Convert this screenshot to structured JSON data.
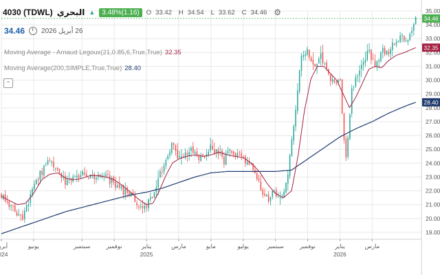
{
  "header": {
    "symbol": "4030 (TDWL)",
    "name": "البحري",
    "change": "3.48%(1.16)",
    "ohlc": [
      {
        "k": "O",
        "v": "33.42"
      },
      {
        "k": "H",
        "v": "34.54"
      },
      {
        "k": "L",
        "v": "33.62"
      },
      {
        "k": "C",
        "v": "34.46"
      }
    ],
    "last_price": "34.46",
    "last_date": "26 أبريل 2026"
  },
  "indicators": {
    "alma_label": "Moving Average - Arnaud Legoux(21,0.85,6,True,True)",
    "alma_value": "32.35",
    "sma_label": "Moving Average(200,SIMPLE,True,True)",
    "sma_value": "28.40"
  },
  "chart_data": {
    "type": "candlestick",
    "y_range": [
      18.5,
      35.0
    ],
    "y_ticks": [
      "19.00",
      "20.00",
      "21.00",
      "22.00",
      "23.00",
      "24.00",
      "25.00",
      "26.00",
      "27.00",
      "28.00",
      "29.00",
      "30.00",
      "31.00",
      "32.00",
      "33.00",
      "34.00",
      "35.00"
    ],
    "x_ticks": [
      {
        "label": "أبريل",
        "year": "2024",
        "t": 0.0
      },
      {
        "label": "يونيو",
        "year": "",
        "t": 2.0
      },
      {
        "label": "سبتمبر",
        "year": "",
        "t": 5.0
      },
      {
        "label": "نوفمبر",
        "year": "",
        "t": 7.0
      },
      {
        "label": "يناير",
        "year": "2025",
        "t": 9.0
      },
      {
        "label": "مارس",
        "year": "",
        "t": 11.0
      },
      {
        "label": "مايو",
        "year": "",
        "t": 13.0
      },
      {
        "label": "يوليو",
        "year": "",
        "t": 15.0
      },
      {
        "label": "سبتمبر",
        "year": "",
        "t": 17.0
      },
      {
        "label": "نوفمبر",
        "year": "",
        "t": 19.0
      },
      {
        "label": "يناير",
        "year": "2026",
        "t": 21.0
      },
      {
        "label": "مارس",
        "year": "",
        "t": 23.0
      }
    ],
    "t_max": 25.8,
    "price_anchors": [
      [
        0.0,
        21.8
      ],
      [
        0.5,
        21.0
      ],
      [
        1.0,
        20.3
      ],
      [
        1.3,
        20.1
      ],
      [
        1.8,
        21.5
      ],
      [
        2.2,
        22.8
      ],
      [
        2.6,
        23.6
      ],
      [
        3.0,
        24.1
      ],
      [
        3.5,
        23.2
      ],
      [
        4.0,
        22.6
      ],
      [
        4.5,
        23.0
      ],
      [
        5.0,
        23.2
      ],
      [
        5.5,
        22.9
      ],
      [
        6.0,
        23.2
      ],
      [
        6.5,
        23.0
      ],
      [
        7.0,
        22.5
      ],
      [
        7.5,
        22.0
      ],
      [
        8.0,
        21.7
      ],
      [
        8.5,
        21.0
      ],
      [
        9.0,
        20.9
      ],
      [
        9.4,
        21.6
      ],
      [
        9.8,
        23.0
      ],
      [
        10.2,
        24.3
      ],
      [
        10.6,
        25.4
      ],
      [
        11.0,
        24.2
      ],
      [
        11.4,
        24.8
      ],
      [
        11.8,
        25.0
      ],
      [
        12.2,
        24.3
      ],
      [
        12.6,
        24.6
      ],
      [
        13.0,
        25.1
      ],
      [
        13.4,
        24.8
      ],
      [
        13.8,
        24.2
      ],
      [
        14.2,
        25.0
      ],
      [
        14.6,
        24.6
      ],
      [
        15.0,
        24.3
      ],
      [
        15.4,
        24.0
      ],
      [
        15.8,
        23.2
      ],
      [
        16.2,
        21.9
      ],
      [
        16.6,
        21.5
      ],
      [
        17.0,
        21.9
      ],
      [
        17.4,
        21.6
      ],
      [
        17.7,
        22.5
      ],
      [
        18.0,
        25.5
      ],
      [
        18.3,
        28.5
      ],
      [
        18.6,
        31.5
      ],
      [
        19.0,
        32.0
      ],
      [
        19.4,
        31.0
      ],
      [
        19.8,
        31.8
      ],
      [
        20.2,
        30.5
      ],
      [
        20.6,
        29.8
      ],
      [
        21.0,
        30.2
      ],
      [
        21.2,
        26.0
      ],
      [
        21.4,
        24.2
      ],
      [
        21.7,
        29.0
      ],
      [
        22.0,
        30.2
      ],
      [
        22.4,
        31.5
      ],
      [
        22.8,
        32.0
      ],
      [
        23.2,
        30.8
      ],
      [
        23.6,
        32.2
      ],
      [
        24.0,
        32.0
      ],
      [
        24.4,
        32.8
      ],
      [
        24.8,
        33.0
      ],
      [
        25.2,
        32.9
      ],
      [
        25.5,
        33.6
      ],
      [
        25.7,
        34.46
      ]
    ],
    "alma_anchors": [
      [
        0.0,
        21.6
      ],
      [
        0.5,
        21.3
      ],
      [
        1.0,
        21.0
      ],
      [
        1.5,
        21.1
      ],
      [
        2.0,
        21.8
      ],
      [
        2.5,
        22.8
      ],
      [
        3.0,
        23.2
      ],
      [
        3.5,
        23.3
      ],
      [
        4.0,
        22.9
      ],
      [
        4.5,
        22.8
      ],
      [
        5.0,
        22.9
      ],
      [
        5.5,
        23.1
      ],
      [
        6.0,
        23.1
      ],
      [
        6.5,
        23.0
      ],
      [
        7.0,
        22.8
      ],
      [
        7.5,
        22.4
      ],
      [
        8.0,
        21.9
      ],
      [
        8.5,
        21.4
      ],
      [
        9.0,
        21.0
      ],
      [
        9.4,
        21.1
      ],
      [
        9.8,
        22.0
      ],
      [
        10.2,
        23.1
      ],
      [
        10.6,
        24.0
      ],
      [
        11.0,
        24.3
      ],
      [
        11.5,
        24.5
      ],
      [
        12.0,
        24.6
      ],
      [
        12.5,
        24.5
      ],
      [
        13.0,
        24.6
      ],
      [
        13.5,
        24.8
      ],
      [
        14.0,
        24.6
      ],
      [
        14.5,
        24.5
      ],
      [
        15.0,
        24.4
      ],
      [
        15.5,
        24.0
      ],
      [
        16.0,
        23.4
      ],
      [
        16.5,
        22.5
      ],
      [
        17.0,
        21.8
      ],
      [
        17.5,
        21.5
      ],
      [
        18.0,
        22.0
      ],
      [
        18.4,
        24.5
      ],
      [
        18.8,
        27.8
      ],
      [
        19.2,
        30.1
      ],
      [
        19.6,
        31.0
      ],
      [
        20.0,
        31.0
      ],
      [
        20.4,
        30.5
      ],
      [
        20.8,
        30.0
      ],
      [
        21.2,
        29.0
      ],
      [
        21.6,
        28.0
      ],
      [
        22.0,
        28.8
      ],
      [
        22.4,
        29.8
      ],
      [
        22.8,
        30.8
      ],
      [
        23.2,
        31.0
      ],
      [
        23.6,
        30.9
      ],
      [
        24.0,
        31.4
      ],
      [
        24.5,
        31.8
      ],
      [
        25.0,
        32.0
      ],
      [
        25.4,
        32.2
      ],
      [
        25.7,
        32.35
      ]
    ],
    "sma_anchors": [
      [
        0.0,
        18.9
      ],
      [
        1.0,
        19.3
      ],
      [
        2.0,
        19.7
      ],
      [
        3.0,
        20.1
      ],
      [
        4.0,
        20.5
      ],
      [
        5.0,
        20.8
      ],
      [
        6.0,
        21.1
      ],
      [
        7.0,
        21.4
      ],
      [
        8.0,
        21.7
      ],
      [
        9.0,
        21.9
      ],
      [
        10.0,
        22.2
      ],
      [
        11.0,
        22.6
      ],
      [
        12.0,
        23.0
      ],
      [
        13.0,
        23.3
      ],
      [
        14.0,
        23.4
      ],
      [
        15.0,
        23.4
      ],
      [
        16.0,
        23.4
      ],
      [
        17.0,
        23.4
      ],
      [
        18.0,
        23.5
      ],
      [
        19.0,
        24.3
      ],
      [
        20.0,
        25.1
      ],
      [
        21.0,
        25.9
      ],
      [
        22.0,
        26.5
      ],
      [
        23.0,
        27.0
      ],
      [
        24.0,
        27.6
      ],
      [
        25.0,
        28.1
      ],
      [
        25.7,
        28.4
      ]
    ],
    "markers": [
      {
        "value": "34.46",
        "y": 34.46,
        "color": "#4caf50"
      },
      {
        "value": "32.35",
        "y": 32.35,
        "color": "#a22040"
      },
      {
        "value": "28.40",
        "y": 28.4,
        "color": "#1e3a6e"
      }
    ],
    "colors": {
      "up": "#26a69a",
      "down": "#ef5350",
      "alma": "#a22040",
      "sma": "#1e3a6e",
      "grid": "#e8e8e8",
      "last_line": "#4caf50"
    }
  }
}
